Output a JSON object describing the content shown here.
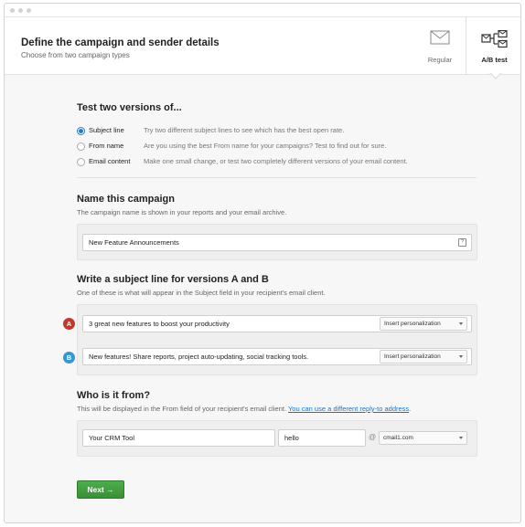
{
  "header": {
    "title": "Define the campaign and sender details",
    "subtitle": "Choose from two campaign types",
    "modes": {
      "regular": "Regular",
      "ab": "A/B test",
      "active": "ab"
    }
  },
  "test": {
    "heading": "Test two versions of...",
    "options": [
      {
        "label": "Subject line",
        "description": "Try two different subject lines to see which has the best open rate.",
        "selected": true
      },
      {
        "label": "From name",
        "description": "Are you using the best From name for your campaigns? Test to find out for sure.",
        "selected": false
      },
      {
        "label": "Email content",
        "description": "Make one small change, or test two completely different versions of your email content.",
        "selected": false
      }
    ]
  },
  "name": {
    "heading": "Name this campaign",
    "description": "The campaign name is shown in your reports and your email archive.",
    "value": "New Feature Announcements"
  },
  "subject": {
    "heading": "Write a subject line for versions A and B",
    "description": "One of these is what will appear in the Subject field in your recipient's email client.",
    "a": {
      "badge": "A",
      "value": "3 great new features to boost your productivity",
      "select": "Insert personalization"
    },
    "b": {
      "badge": "B",
      "value": "New features! Share reports, project auto-updating, social tracking tools.",
      "select": "Insert personalization"
    }
  },
  "from": {
    "heading": "Who is it from?",
    "description": "This will be displayed in the From field of your recipient's email client.",
    "link": "You can use a different reply-to address",
    "link_suffix": ".",
    "name_value": "Your CRM Tool",
    "email_user": "hello",
    "at": "@",
    "domain": "cmail1.com"
  },
  "next_label": "Next →",
  "colors": {
    "accent": "#3598d3",
    "badge_a": "#c0392b",
    "next": "#4cae4c"
  }
}
